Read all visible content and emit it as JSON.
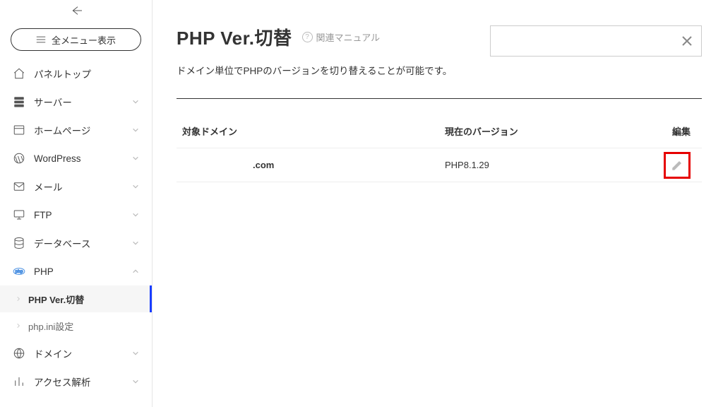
{
  "sidebar": {
    "all_menu_label": "全メニュー表示",
    "items": [
      {
        "label": "パネルトップ"
      },
      {
        "label": "サーバー"
      },
      {
        "label": "ホームページ"
      },
      {
        "label": "WordPress"
      },
      {
        "label": "メール"
      },
      {
        "label": "FTP"
      },
      {
        "label": "データベース"
      },
      {
        "label": "PHP"
      },
      {
        "label": "ドメイン"
      },
      {
        "label": "アクセス解析"
      }
    ],
    "php_sub": [
      {
        "label": "PHP Ver.切替"
      },
      {
        "label": "php.ini設定"
      }
    ]
  },
  "main": {
    "title": "PHP Ver.切替",
    "manual_link": "関連マニュアル",
    "description": "ドメイン単位でPHPのバージョンを切り替えることが可能です。",
    "table": {
      "headers": {
        "domain": "対象ドメイン",
        "version": "現在のバージョン",
        "edit": "編集"
      },
      "rows": [
        {
          "domain": ".com",
          "version": "PHP8.1.29"
        }
      ]
    }
  }
}
